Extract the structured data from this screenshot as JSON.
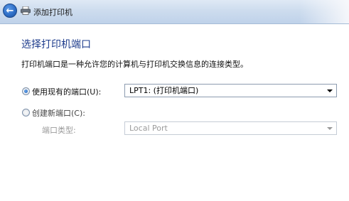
{
  "window": {
    "title": "添加打印机",
    "back_icon": "back-arrow-icon",
    "app_icon": "printer-icon"
  },
  "page": {
    "heading": "选择打印机端口",
    "description": "打印机端口是一种允许您的计算机与打印机交换信息的连接类型。"
  },
  "options": {
    "use_existing": {
      "label": "使用现有的端口(U):",
      "selected": true,
      "value": "LPT1: (打印机端口)"
    },
    "create_new": {
      "label": "创建新端口(C):",
      "selected": false,
      "port_type_label": "端口类型:",
      "port_type_value": "Local Port"
    }
  },
  "colors": {
    "heading": "#1e3c8c",
    "disabled_text": "#9b9b9b"
  }
}
